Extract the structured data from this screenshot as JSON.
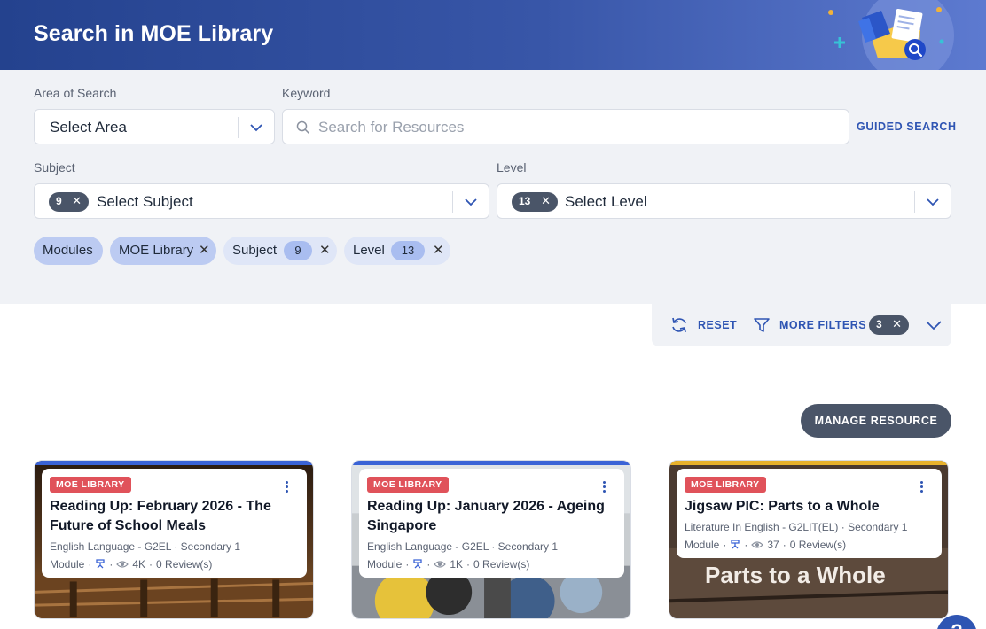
{
  "header": {
    "title": "Search in MOE Library"
  },
  "filters": {
    "area": {
      "label": "Area of Search",
      "value": "Select Area"
    },
    "keyword": {
      "label": "Keyword",
      "placeholder": "Search for Resources"
    },
    "guided_search": "GUIDED SEARCH",
    "subject": {
      "label": "Subject",
      "count": "9",
      "value": "Select Subject"
    },
    "level": {
      "label": "Level",
      "count": "13",
      "value": "Select Level"
    }
  },
  "chips": {
    "modules": "Modules",
    "moe_library": "MOE Library",
    "subject": {
      "label": "Subject",
      "count": "9"
    },
    "level": {
      "label": "Level",
      "count": "13"
    }
  },
  "toolbar": {
    "reset": "RESET",
    "more_filters": "MORE FILTERS",
    "filter_count": "3"
  },
  "manage_resource": "MANAGE RESOURCE",
  "cards": [
    {
      "tag": "MOE LIBRARY",
      "title": "Reading Up: February 2026 - The Future of School Meals",
      "meta": "English Language - G2EL · Secondary 1",
      "type": "Module",
      "views": "4K",
      "reviews": "0 Review(s)",
      "accent": "#3a63d6"
    },
    {
      "tag": "MOE LIBRARY",
      "title": "Reading Up: January 2026 - Ageing Singapore",
      "meta": "English Language - G2EL · Secondary 1",
      "type": "Module",
      "views": "1K",
      "reviews": "0 Review(s)",
      "accent": "#3a63d6"
    },
    {
      "tag": "MOE LIBRARY",
      "title": "Jigsaw PIC: Parts to a Whole",
      "meta": "Literature In English - G2LIT(EL) · Secondary 1",
      "type": "Module",
      "views": "37",
      "reviews": "0 Review(s)",
      "accent": "#e8b22c",
      "image_text": "Parts to a Whole"
    }
  ],
  "colors": {
    "brand": "#2f55b3",
    "header_start": "#24428e",
    "tag": "#e0525a",
    "dark_button": "#4a5568"
  }
}
